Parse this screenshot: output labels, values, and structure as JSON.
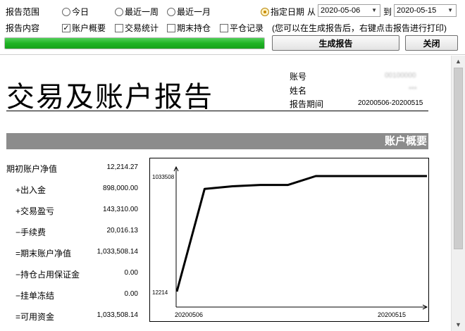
{
  "toolbar": {
    "range_label": "报告范围",
    "range_options": [
      "今日",
      "最近一周",
      "最近一月",
      "指定日期"
    ],
    "range_selected": "指定日期",
    "from_label": "从",
    "from_date": "2020-05-06",
    "to_label": "到",
    "to_date": "2020-05-15",
    "content_label": "报告内容",
    "content_options": [
      {
        "label": "账户概要",
        "checked": true
      },
      {
        "label": "交易统计",
        "checked": false
      },
      {
        "label": "期末持仓",
        "checked": false
      },
      {
        "label": "平仓记录",
        "checked": false
      }
    ],
    "hint": "(您可以在生成报告后，右键点击报告进行打印)",
    "progress_percent": 100,
    "generate_label": "生成报告",
    "close_label": "关闭"
  },
  "report": {
    "title": "交易及账户报告",
    "account_label": "账号",
    "account_value": "00100000",
    "name_label": "姓名",
    "name_value": "*** ",
    "period_label": "报告期间",
    "period_value": "20200506-20200515",
    "section_title": "账户概要",
    "rows": [
      {
        "label": "期初账户净值",
        "value": "12,214.27"
      },
      {
        "label": "+出入金",
        "value": "898,000.00"
      },
      {
        "label": "+交易盈亏",
        "value": "143,310.00"
      },
      {
        "label": "−手续费",
        "value": "20,016.13"
      },
      {
        "label": "=期末账户净值",
        "value": "1,033,508.14"
      },
      {
        "label": "−持仓占用保证金",
        "value": "0.00"
      },
      {
        "label": "−挂单冻结",
        "value": "0.00"
      },
      {
        "label": "=可用资金",
        "value": "1,033,508.14"
      }
    ]
  },
  "chart_data": {
    "type": "line",
    "title": "",
    "xlabel": "",
    "ylabel": "",
    "x_tick_labels": [
      "20200506",
      "20200515"
    ],
    "y_tick_labels": [
      "12214",
      "1033508"
    ],
    "ylim": [
      12214,
      1033508
    ],
    "series": [
      {
        "color": "#000000",
        "x": [
          "20200506",
          "20200507",
          "20200508",
          "20200509",
          "20200510",
          "20200511",
          "20200512",
          "20200513",
          "20200514",
          "20200515"
        ],
        "values": [
          12214,
          920000,
          943000,
          955000,
          955000,
          1033508,
          1033508,
          1033508,
          1033508,
          1033508
        ]
      }
    ]
  }
}
